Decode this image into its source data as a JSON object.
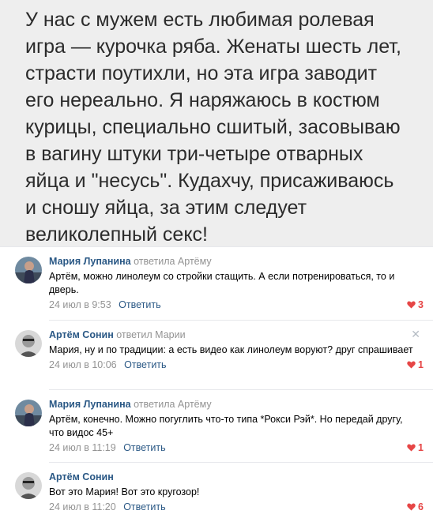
{
  "post": {
    "text": "У нас с мужем есть любимая ролевая игра — курочка ряба. Женаты шесть лет, страсти поутихли, но эта игра заводит его нереально. Я наряжаюсь в костюм курицы, специально сшитый, засовываю в вагину штуки три-четыре отварных яйца и \"несусь\". Кудахчу, присаживаюсь и сношу яйца, за этим следует великолепный секс!"
  },
  "comments": [
    {
      "author": "Мария Лупанина",
      "replied": "ответила Артёму",
      "text": "Артём, можно линолеум со стройки стащить. А если потренироваться, то и дверь.",
      "time": "24 июл в 9:53",
      "reply_label": "Ответить",
      "likes": "3",
      "avatar": "mariya-avatar"
    },
    {
      "author": "Артём Сонин",
      "replied": "ответил Марии",
      "text": "Мария, ну и по традиции: а есть видео как линолеум воруют? друг спрашивает",
      "time": "24 июл в 10:06",
      "reply_label": "Ответить",
      "likes": "1",
      "avatar": "artem-avatar"
    },
    {
      "author": "Мария Лупанина",
      "replied": "ответила Артёму",
      "text": "Артём, конечно. Можно погуглить что-то типа *Рокси Рэй*. Но передай другу, что видос 45+",
      "time": "24 июл в 11:19",
      "reply_label": "Ответить",
      "likes": "1",
      "avatar": "mariya-avatar"
    },
    {
      "author": "Артём Сонин",
      "replied": "",
      "text": "Вот это Мария! Вот это кругозор!",
      "time": "24 июл в 11:20",
      "reply_label": "Ответить",
      "likes": "6",
      "avatar": "artem-avatar"
    }
  ],
  "colors": {
    "link": "#2a5885",
    "like": "#e64646",
    "post_bg": "#eeeeee"
  },
  "icons": {
    "like": "heart-icon",
    "close": "close-icon"
  },
  "close_glyph": "✕"
}
